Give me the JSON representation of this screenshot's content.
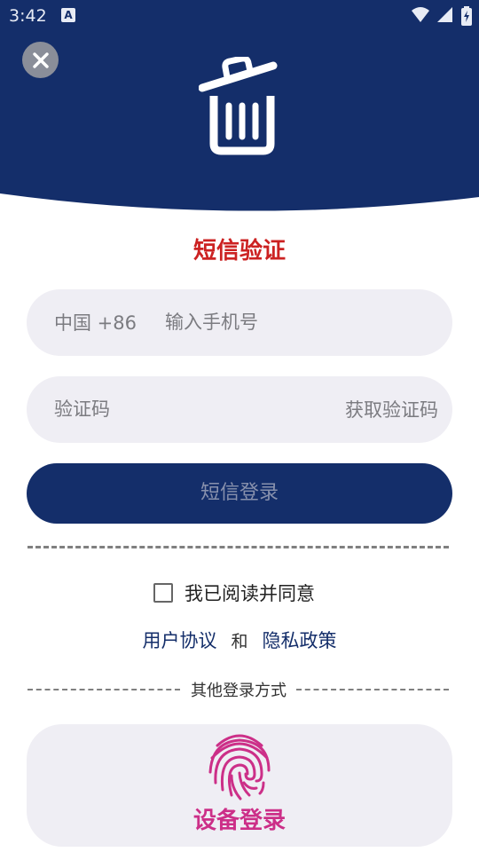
{
  "status_bar": {
    "time": "3:42",
    "app_icon": "A"
  },
  "header": {
    "close_icon": "close-icon",
    "trash_icon": "trash-icon",
    "bg_color": "#142e6a"
  },
  "title": "短信验证",
  "phone_field": {
    "country_code": "中国 +86",
    "placeholder": "输入手机号"
  },
  "code_field": {
    "placeholder": "验证码",
    "get_code_label": "获取验证码"
  },
  "login_button": "短信登录",
  "agreement": {
    "checked": false,
    "text": "我已阅读并同意",
    "user_agreement": "用户协议",
    "and": "和",
    "privacy_policy": "隐私政策"
  },
  "other_login": {
    "label": "其他登录方式",
    "device_login": "设备登录",
    "icon": "fingerprint-icon"
  },
  "colors": {
    "primary": "#142e6a",
    "title_red": "#cc2222",
    "device_pink": "#cc2f88",
    "field_bg": "#efeef4"
  }
}
